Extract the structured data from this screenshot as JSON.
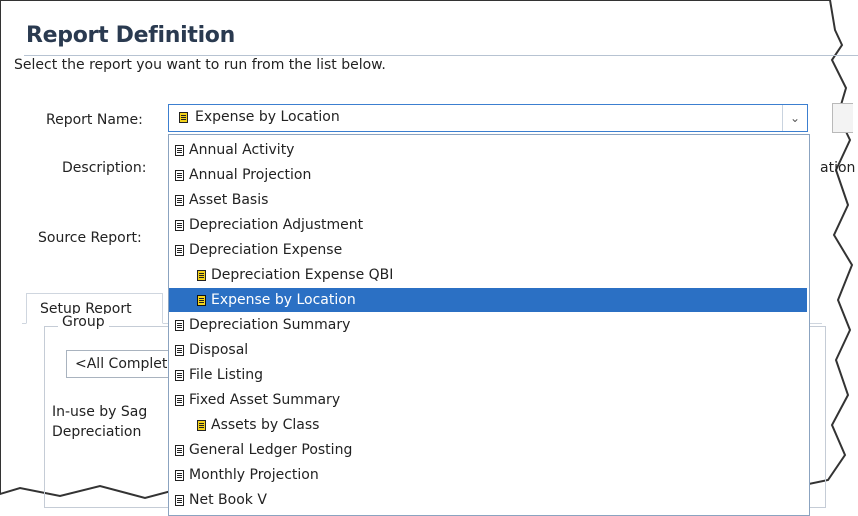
{
  "header": {
    "title": "Report Definition",
    "instruction": "Select the report you want to run from the list below."
  },
  "form": {
    "report_name_label": "Report Name:",
    "report_name_value": "Expense by Location",
    "description_label": "Description:",
    "description_partial": "ation",
    "source_report_label": "Source Report:"
  },
  "tabs": [
    {
      "label": "Setup Report",
      "active": true
    }
  ],
  "group": {
    "label": "Group",
    "value": "<All Complet",
    "inuse_text": "In-use by Sag Depreciation"
  },
  "dropdown": {
    "items": [
      {
        "label": "Annual Activity",
        "level": 0,
        "icon": "document-icon"
      },
      {
        "label": "Annual Projection",
        "level": 0,
        "icon": "document-icon"
      },
      {
        "label": "Asset Basis",
        "level": 0,
        "icon": "document-icon"
      },
      {
        "label": "Depreciation Adjustment",
        "level": 0,
        "icon": "document-icon"
      },
      {
        "label": "Depreciation Expense",
        "level": 0,
        "icon": "document-icon"
      },
      {
        "label": "Depreciation Expense QBI",
        "level": 1,
        "icon": "custom-report-icon"
      },
      {
        "label": "Expense by Location",
        "level": 1,
        "icon": "custom-report-icon",
        "selected": true
      },
      {
        "label": "Depreciation Summary",
        "level": 0,
        "icon": "document-icon"
      },
      {
        "label": "Disposal",
        "level": 0,
        "icon": "document-icon"
      },
      {
        "label": "File Listing",
        "level": 0,
        "icon": "document-icon"
      },
      {
        "label": "Fixed Asset Summary",
        "level": 0,
        "icon": "document-icon"
      },
      {
        "label": "Assets by Class",
        "level": 1,
        "icon": "custom-report-icon"
      },
      {
        "label": "General Ledger Posting",
        "level": 0,
        "icon": "document-icon"
      },
      {
        "label": "Monthly Projection",
        "level": 0,
        "icon": "document-icon"
      },
      {
        "label": "Net Book V",
        "level": 0,
        "icon": "document-icon"
      }
    ]
  },
  "colors": {
    "selection": "#2b70c4",
    "custom_icon": "#f3d21c",
    "title": "#2a3a50"
  }
}
